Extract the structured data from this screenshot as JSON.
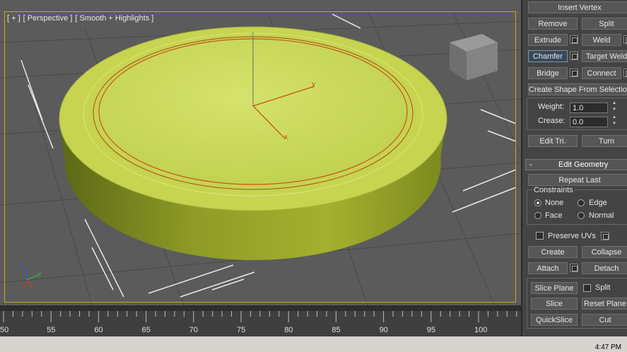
{
  "viewport": {
    "label_plus": "[ + ]",
    "label_view": "[ Perspective ]",
    "label_shading": "[ Smooth + Highlights ]",
    "axis_x": "x",
    "axis_y": "y",
    "axis_z": "z",
    "mini_axis_x": "x",
    "mini_axis_y": "y",
    "mini_axis_z": "z"
  },
  "timeline": {
    "ticks": [
      "50",
      "55",
      "60",
      "65",
      "70",
      "75",
      "80",
      "85",
      "90",
      "95",
      "100"
    ]
  },
  "status": {
    "clock": "4:47 PM"
  },
  "panel": {
    "insert_vertex": "Insert Vertex",
    "remove": "Remove",
    "split": "Split",
    "extrude": "Extrude",
    "weld": "Weld",
    "chamfer": "Chamfer",
    "target_weld": "Target Weld",
    "bridge": "Bridge",
    "connect": "Connect",
    "create_shape": "Create Shape From Selection",
    "weight_label": "Weight:",
    "weight_value": "1.0",
    "crease_label": "Crease:",
    "crease_value": "0.0",
    "edit_tri": "Edit Tri.",
    "turn": "Turn",
    "edit_geometry_toggle": "-",
    "edit_geometry": "Edit Geometry",
    "repeat_last": "Repeat Last",
    "constraints": "Constraints",
    "none": "None",
    "edge": "Edge",
    "face": "Face",
    "normal": "Normal",
    "preserve_uvs": "Preserve UVs",
    "create": "Create",
    "collapse": "Collapse",
    "attach": "Attach",
    "detach": "Detach",
    "slice_plane": "Slice Plane",
    "split2": "Split",
    "slice": "Slice",
    "reset_plane": "Reset Plane",
    "quickslice": "QuickSlice",
    "cut": "Cut"
  }
}
